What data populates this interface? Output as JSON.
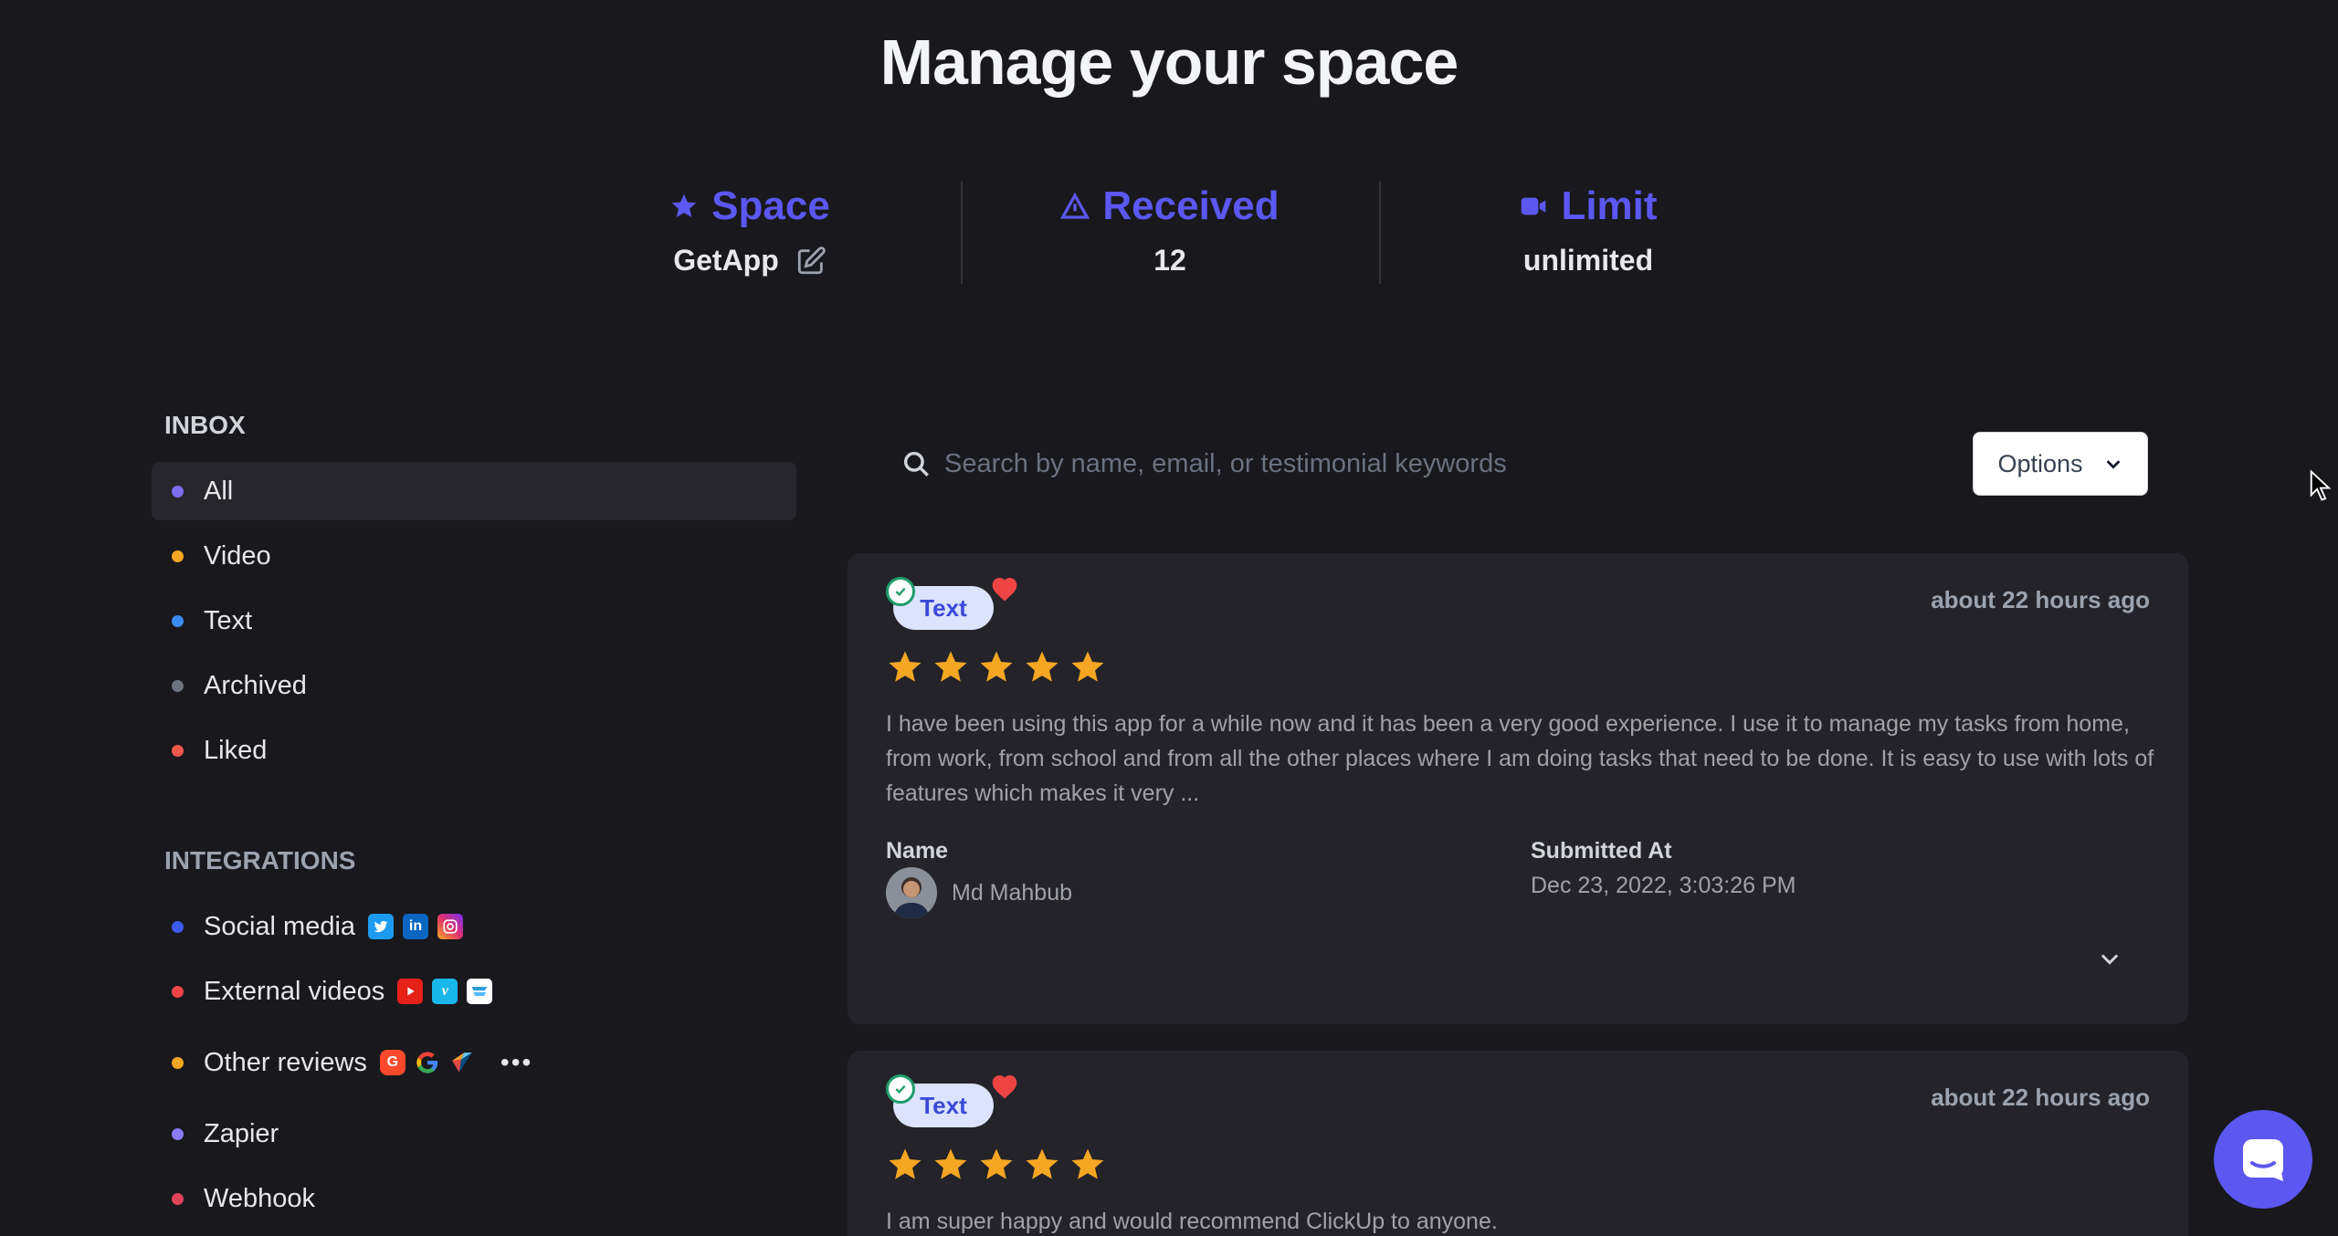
{
  "page": {
    "title": "Manage your space"
  },
  "stats": {
    "space": {
      "label": "Space",
      "value": "GetApp"
    },
    "received": {
      "label": "Received",
      "value": "12"
    },
    "limit": {
      "label": "Limit",
      "value": "unlimited"
    }
  },
  "colors": {
    "accent": "#5b57f0",
    "star": "#f5a623",
    "heart": "#ef4444",
    "check": "#1f9d6a"
  },
  "sidebar": {
    "inbox_title": "INBOX",
    "inbox_items": [
      {
        "label": "All",
        "color": "#7c6df2",
        "active": true
      },
      {
        "label": "Video",
        "color": "#f5a623"
      },
      {
        "label": "Text",
        "color": "#3b8cf0"
      },
      {
        "label": "Archived",
        "color": "#6b7280"
      },
      {
        "label": "Liked",
        "color": "#ef5a4a"
      }
    ],
    "integrations_title": "INTEGRATIONS",
    "integrations": [
      {
        "label": "Social media",
        "color": "#3b5bf0",
        "icons": [
          "twitter-icon",
          "linkedin-icon",
          "instagram-icon"
        ]
      },
      {
        "label": "External videos",
        "color": "#ef4444",
        "icons": [
          "youtube-icon",
          "vimeo-icon",
          "wistia-icon"
        ]
      },
      {
        "label": "Other reviews",
        "color": "#f5a623",
        "icons": [
          "g2-icon",
          "google-icon",
          "capterra-icon",
          "more-icon"
        ]
      },
      {
        "label": "Zapier",
        "color": "#8b7cf6"
      },
      {
        "label": "Webhook",
        "color": "#e0445a"
      }
    ]
  },
  "search": {
    "placeholder": "Search by name, email, or testimonial keywords"
  },
  "options_button": {
    "label": "Options"
  },
  "testimonials": [
    {
      "type": "Text",
      "time": "about 22 hours ago",
      "rating": 5,
      "text": "I have been using this app for a while now and it has been a very good experience. I use it to manage my tasks from home, from work, from school and from all the other places where I am doing tasks that need to be done. It is easy to use with lots of features which makes it very ...",
      "name_label": "Name",
      "name": "Md Mahbub",
      "submitted_label": "Submitted At",
      "submitted": "Dec 23, 2022, 3:03:26 PM"
    },
    {
      "type": "Text",
      "time": "about 22 hours ago",
      "rating": 5,
      "text": "I am super happy and would recommend ClickUp to anyone."
    }
  ]
}
